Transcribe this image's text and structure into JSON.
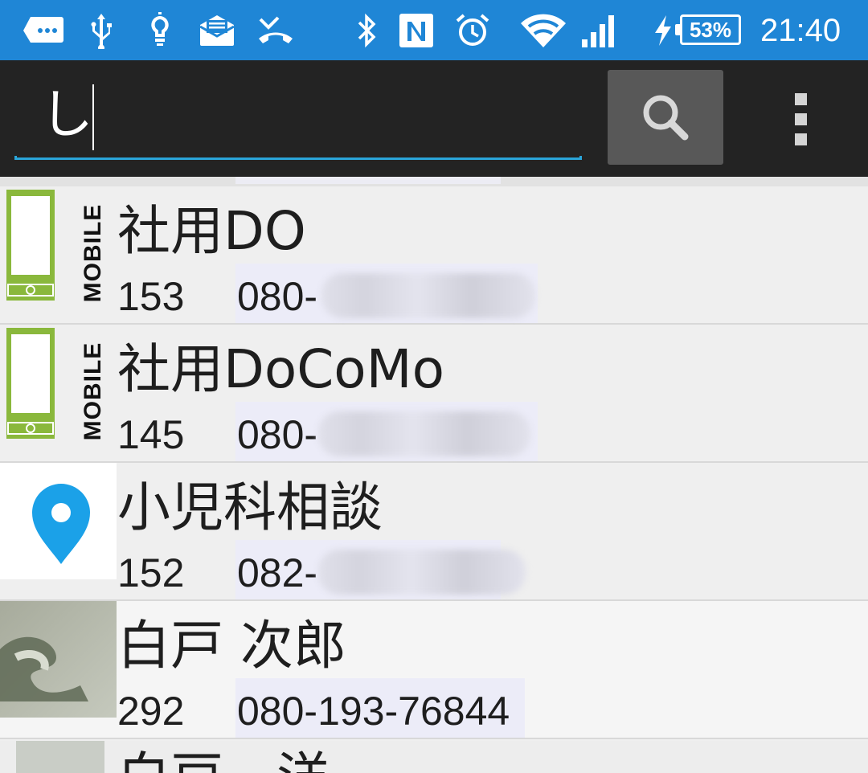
{
  "status_bar": {
    "battery": "53%",
    "time": "21:40",
    "icons": [
      "message-icon",
      "usb-icon",
      "lightbulb-icon",
      "email-icon",
      "missed-call-icon",
      "bluetooth-icon",
      "nfc-icon",
      "alarm-icon",
      "wifi-icon",
      "signal-icon",
      "charging-icon",
      "battery-icon"
    ]
  },
  "search": {
    "query": "し",
    "button_icon": "search-icon",
    "overflow_icon": "overflow-menu-icon"
  },
  "contacts": [
    {
      "name": "社用DO",
      "speed_dial": "153",
      "phone": "080-",
      "avatar": "mobile-phone-icon",
      "avatar_label": "MOBILE"
    },
    {
      "name": "社用DoCoMo",
      "speed_dial": "145",
      "phone": "080-",
      "avatar": "mobile-phone-icon",
      "avatar_label": "MOBILE"
    },
    {
      "name": "小児科相談",
      "speed_dial": "152",
      "phone": "082-",
      "avatar": "map-pin-icon"
    },
    {
      "name": "白戸 次郎",
      "speed_dial": "292",
      "phone": "080-193-76844",
      "avatar": "photo-avatar"
    }
  ],
  "partial_contact": {
    "name": "白戸　洋"
  },
  "colors": {
    "status_bar": "#1f86d6",
    "search_bar": "#232323",
    "accent_underline": "#2aa5d9",
    "mobile_green": "#8ab83c",
    "pin_blue": "#1ba1e8"
  }
}
